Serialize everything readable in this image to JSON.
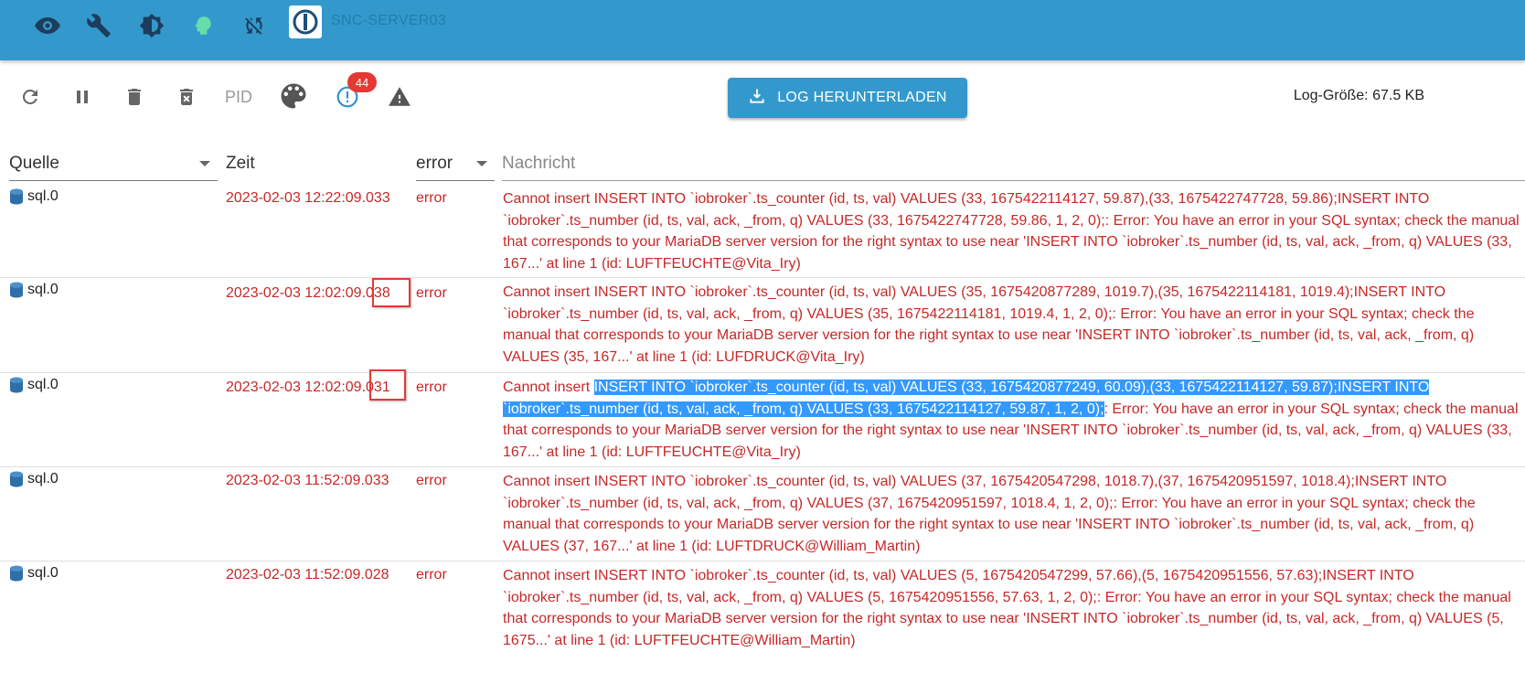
{
  "header": {
    "hostname": "SNC-SERVER03",
    "icons": [
      "eye-icon",
      "wrench-icon",
      "brightness-icon",
      "head-icon",
      "sync-disabled-icon"
    ]
  },
  "toolbar": {
    "pid_label": "PID",
    "badge_count": "44",
    "download_label": "LOG HERUNTERLADEN",
    "log_size": "Log-Größe: 67.5 KB"
  },
  "table": {
    "columns": {
      "source": "Quelle",
      "time": "Zeit",
      "severity": "error",
      "message": "Nachricht"
    },
    "rows": [
      {
        "source": "sql.0",
        "time_main": "2023-02-03 12:22:09.033",
        "time_ms": "",
        "severity": "error",
        "msg_pre": "Cannot insert INSERT INTO `iobroker`.ts_counter (id, ts, val) VALUES (33, 1675422114127, 59.87),(33, 1675422747728, 59.86);INSERT INTO `iobroker`.ts_number (id, ts, val, ack, _from, q) VALUES (33, 1675422747728, 59.86, 1, 2, 0);: Error: You have an error in your SQL syntax; check the manual that corresponds to your MariaDB server version for the right syntax to use near 'INSERT INTO `iobroker`.ts_number (id, ts, val, ack, _from, q) VALUES (33, 167...' at line 1 (id: LUFTFEUCHTE@Vita_Iry)",
        "msg_sel": "",
        "msg_post": ""
      },
      {
        "source": "sql.0",
        "time_main": "2023-02-03 12:02:09.",
        "time_ms": "038",
        "severity": "error",
        "msg_pre": "Cannot insert INSERT INTO `iobroker`.ts_counter (id, ts, val) VALUES (35, 1675420877289, 1019.7),(35, 1675422114181, 1019.4);INSERT INTO `iobroker`.ts_number (id, ts, val, ack, _from, q) VALUES (35, 1675422114181, 1019.4, 1, 2, 0);: Error: You have an error in your SQL syntax; check the manual that corresponds to your MariaDB server version for the right syntax to use near 'INSERT INTO `iobroker`.ts_number (id, ts, val, ack, _from, q) VALUES (35, 167...' at line 1 (id: LUFDRUCK@Vita_Iry)",
        "msg_sel": "",
        "msg_post": ""
      },
      {
        "source": "sql.0",
        "time_main": "2023-02-03 12:02:09.",
        "time_ms": "031",
        "severity": "error",
        "msg_pre": "Cannot insert ",
        "msg_sel": "INSERT INTO `iobroker`.ts_counter (id, ts, val) VALUES (33, 1675420877249, 60.09),(33, 1675422114127, 59.87);INSERT INTO `iobroker`.ts_number (id, ts, val, ack, _from, q) VALUES (33, 1675422114127, 59.87, 1, 2, 0);",
        "msg_post": ": Error: You have an error in your SQL syntax; check the manual that corresponds to your MariaDB server version for the right syntax to use near 'INSERT INTO `iobroker`.ts_number (id, ts, val, ack, _from, q) VALUES (33, 167...' at line 1 (id: LUFTFEUCHTE@Vita_Iry)"
      },
      {
        "source": "sql.0",
        "time_main": "2023-02-03 11:52:09.033",
        "time_ms": "",
        "severity": "error",
        "msg_pre": "Cannot insert INSERT INTO `iobroker`.ts_counter (id, ts, val) VALUES (37, 1675420547298, 1018.7),(37, 1675420951597, 1018.4);INSERT INTO `iobroker`.ts_number (id, ts, val, ack, _from, q) VALUES (37, 1675420951597, 1018.4, 1, 2, 0);: Error: You have an error in your SQL syntax; check the manual that corresponds to your MariaDB server version for the right syntax to use near 'INSERT INTO `iobroker`.ts_number (id, ts, val, ack, _from, q) VALUES (37, 167...' at line 1 (id: LUFTDRUCK@William_Martin)",
        "msg_sel": "",
        "msg_post": ""
      },
      {
        "source": "sql.0",
        "time_main": "2023-02-03 11:52:09.028",
        "time_ms": "",
        "severity": "error",
        "msg_pre": "Cannot insert INSERT INTO `iobroker`.ts_counter (id, ts, val) VALUES (5, 1675420547299, 57.66),(5, 1675420951556, 57.63);INSERT INTO `iobroker`.ts_number (id, ts, val, ack, _from, q) VALUES (5, 1675420951556, 57.63, 1, 2, 0);: Error: You have an error in your SQL syntax; check the manual that corresponds to your MariaDB server version for the right syntax to use near 'INSERT INTO `iobroker`.ts_number (id, ts, val, ack, _from, q) VALUES (5, 1675...' at line 1 (id: LUFTFEUCHTE@William_Martin)",
        "msg_sel": "",
        "msg_post": ""
      }
    ]
  },
  "colors": {
    "primary": "#3399cc",
    "error": "#c62828",
    "selection": "#3399ff",
    "badge": "#e53935"
  }
}
